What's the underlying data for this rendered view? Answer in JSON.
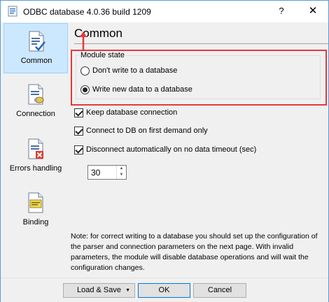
{
  "window": {
    "title": "ODBC database 4.0.36 build 1209",
    "help_label": "?",
    "close_label": "✕"
  },
  "sidebar": {
    "items": [
      {
        "label": "Common",
        "icon": "document-check-icon",
        "selected": true
      },
      {
        "label": "Connection",
        "icon": "document-plug-icon",
        "selected": false
      },
      {
        "label": "Errors handling",
        "icon": "document-error-icon",
        "selected": false
      },
      {
        "label": "Binding",
        "icon": "document-binding-icon",
        "selected": false
      }
    ]
  },
  "main": {
    "heading": "Common",
    "module_state": {
      "legend": "Module state",
      "options": [
        {
          "label": "Don't write to a database",
          "selected": false
        },
        {
          "label": "Write new data to a database",
          "selected": true
        }
      ]
    },
    "checkboxes": [
      {
        "label": "Keep database connection",
        "checked": true
      },
      {
        "label": "Connect to DB on first demand only",
        "checked": true
      },
      {
        "label": "Disconnect automatically on no data timeout (sec)",
        "checked": true
      }
    ],
    "timeout_value": "30",
    "note": "Note: for correct writing to a database you should set up the configuration of the parser and connection parameters on the next page. With invalid parameters, the module will disable database operations and will wait the configuration changes."
  },
  "buttons": {
    "load_save": "Load & Save",
    "ok": "OK",
    "cancel": "Cancel"
  },
  "colors": {
    "highlight_frame": "#e8383d",
    "selected_bg": "#cce8ff",
    "default_button_border": "#0078d7"
  }
}
